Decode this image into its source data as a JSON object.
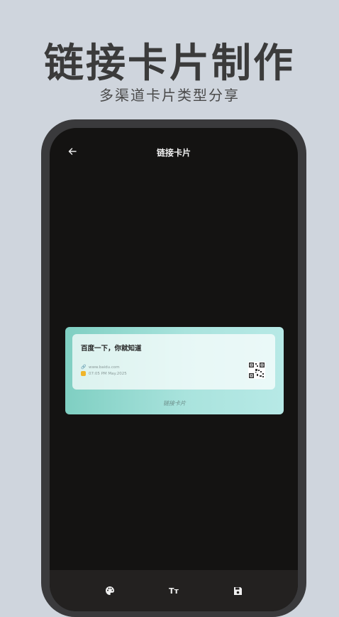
{
  "hero": {
    "title": "链接卡片制作",
    "subtitle": "多渠道卡片类型分享"
  },
  "app": {
    "screen_title": "链接卡片",
    "back_icon": "arrow-left-icon"
  },
  "card": {
    "heading": "百度一下，你就知道",
    "url": "www.baidu.com",
    "timestamp": "07:05 PM May.2025",
    "footer": "链接卡片",
    "gradient_start": "#7fcfc2",
    "gradient_end": "#b7e9e6"
  },
  "toolbar": {
    "palette_icon": "palette-icon",
    "text_icon_label": "Tт",
    "save_icon": "save-icon"
  }
}
